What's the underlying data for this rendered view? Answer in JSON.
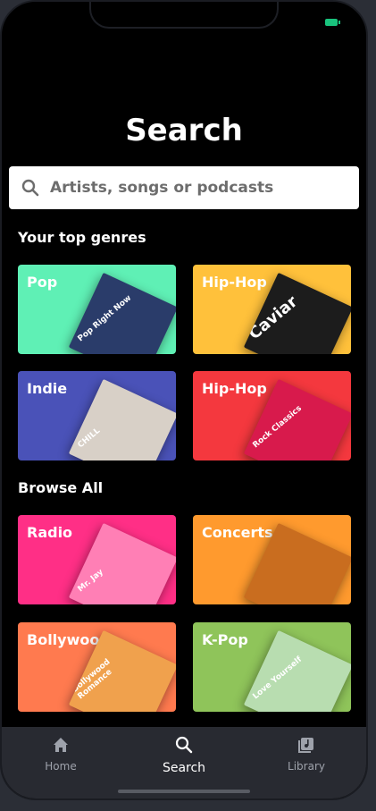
{
  "header": {
    "title": "Search"
  },
  "search": {
    "placeholder": "Artists, songs or podcasts"
  },
  "sections": {
    "top_genres": "Your top genres",
    "browse_all": "Browse All"
  },
  "cards": [
    {
      "label": "Pop",
      "bg": "#5ff0b5",
      "art_bg": "#2a3c6a",
      "art_text": "Pop Right Now"
    },
    {
      "label": "Hip-Hop",
      "bg": "#ffc13b",
      "art_bg": "#1c1c1c",
      "art_text": "Caviar"
    },
    {
      "label": "Indie",
      "bg": "#4a52b8",
      "art_bg": "#d8d0c7",
      "art_text": "CHILL"
    },
    {
      "label": "Hip-Hop",
      "bg": "#f4383e",
      "art_bg": "#d81a4c",
      "art_text": "Rock Classics"
    },
    {
      "label": "Radio",
      "bg": "#ff2f86",
      "art_bg": "#ff7fb5",
      "art_text": "Mr. Jay"
    },
    {
      "label": "Concerts",
      "bg": "#ff9a2e",
      "art_bg": "#c96d1f",
      "art_text": ""
    },
    {
      "label": "Bollywood",
      "bg": "#ff7a4f",
      "art_bg": "#f0a14d",
      "art_text": "Bollywood Romance"
    },
    {
      "label": "K-Pop",
      "bg": "#8fc45a",
      "art_bg": "#b8ddb0",
      "art_text": "Love Yourself"
    }
  ],
  "nav": {
    "home": "Home",
    "search": "Search",
    "library": "Library"
  },
  "colors": {
    "background": "#000000",
    "nav_bg": "#282a31",
    "battery": "#19c37d"
  }
}
